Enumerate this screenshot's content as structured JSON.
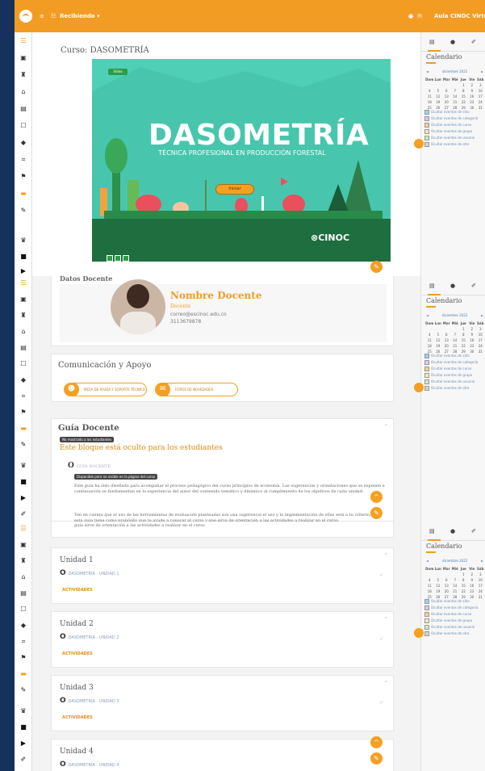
{
  "topbar": {
    "menu_icon": "≡",
    "grid_icon": "☷",
    "site_label": "Recibiendo ▾",
    "notif_icon": "●",
    "msg_icon": "✉",
    "user_name": "Aula CINOC Virtual"
  },
  "nav": {
    "items": [
      "☰",
      "▣",
      "♜",
      "⌂",
      "▤",
      "☐",
      "◆",
      "⌗",
      "⚑",
      "▬",
      "✎",
      "✂",
      "♛",
      "■",
      "▶",
      "✐"
    ]
  },
  "course": {
    "title": "Curso: DASOMETRÍA",
    "banner": {
      "tag": "Video",
      "title": "DASOMETRÍA",
      "subtitle": "TÉCNICA PROFESIONAL EN PRODUCCIÓN FORESTAL",
      "start_button": "Iniciar",
      "brand": "⊗CINOC"
    }
  },
  "teacher": {
    "section_title": "Datos Docente",
    "name": "Nombre Docente",
    "role": "Docente",
    "email": "correo@escinoc.edu.co",
    "phone": "3113679878"
  },
  "support": {
    "title": "Comunicación y Apoyo",
    "btn_help": "MESA DE AYUDA Y SOPORTE TÉCNICO",
    "btn_forum": "FOROS DE NOVEDADES"
  },
  "guide": {
    "title": "Guía Docente",
    "hidden_tag": "No mostrado a los estudiantes",
    "hidden_heading": "Este bloque está oculto para los estudiantes",
    "resource_name": "GUÍA DOCENTE",
    "visible_tag": "Disponible pero no visible en la página del curso",
    "para1": "Este guía ha sido diseñada para acompañar el proceso pedagógico del curso principios de economía. Las sugerencias y orientaciones que se exponen a continuación se fundamentan en la experiencia del autor del contenido temático y dinámico al cumplimiento de los objetivos de cada unidad.",
    "para2": "Ten en cuenta que el uso de las herramientas de evaluación planteadas son una sugerencia el uso y la implementación de ellas está a tu criterio, pues esta guía tiene como propósito que te ayude a conocer el curso y que sirva de orientación a las actividades a realizar en el curso.",
    "para2_end": "guía sirve de orientación a las actividades a realizar en el curso"
  },
  "units": [
    {
      "title": "Unidad 1",
      "link": "DASOMETRÍA - UNIDAD 1",
      "activities": "ACTIVIDADES"
    },
    {
      "title": "Unidad 2",
      "link": "DASOMETRÍA - UNIDAD 2",
      "activities": "ACTIVIDADES"
    },
    {
      "title": "Unidad 3",
      "link": "DASOMETRÍA - UNIDAD 3",
      "activities": "ACTIVIDADES"
    },
    {
      "title": "Unidad 4",
      "link": "DASOMETRÍA - UNIDAD 4",
      "activities": "ACTIVIDADES"
    }
  ],
  "calendar": {
    "tab_icons": [
      "▤",
      "●",
      "✐"
    ],
    "title": "Calendario",
    "prev": "◄",
    "month": "diciembre 2022",
    "next": "►",
    "weekdays": [
      "Dom",
      "Lun",
      "Mar",
      "Mié",
      "Jue",
      "Vie",
      "Sáb"
    ],
    "weeks": [
      [
        "",
        "",
        "",
        "",
        "1",
        "2",
        "3"
      ],
      [
        "4",
        "5",
        "6",
        "7",
        "8",
        "9",
        "10"
      ],
      [
        "11",
        "12",
        "13",
        "14",
        "15",
        "16",
        "17"
      ],
      [
        "18",
        "19",
        "20",
        "21",
        "22",
        "23",
        "24"
      ],
      [
        "25",
        "26",
        "27",
        "28",
        "29",
        "30",
        "31"
      ]
    ],
    "legend": [
      "Ocultar eventos de sitio",
      "Ocultar eventos de categoría",
      "Ocultar eventos de curso",
      "Ocultar eventos de grupo",
      "Ocultar eventos de usuario",
      "Ocultar eventos de otro"
    ],
    "legend_colors": [
      "#9bd0f2",
      "#d8c7f0",
      "#f6d08a",
      "#f4e5b8",
      "#cde8c6",
      "#cfd3da"
    ]
  },
  "colors": {
    "accent": "#f39c24",
    "banner": "#47c6ad",
    "nav_bg": "#16315c"
  }
}
